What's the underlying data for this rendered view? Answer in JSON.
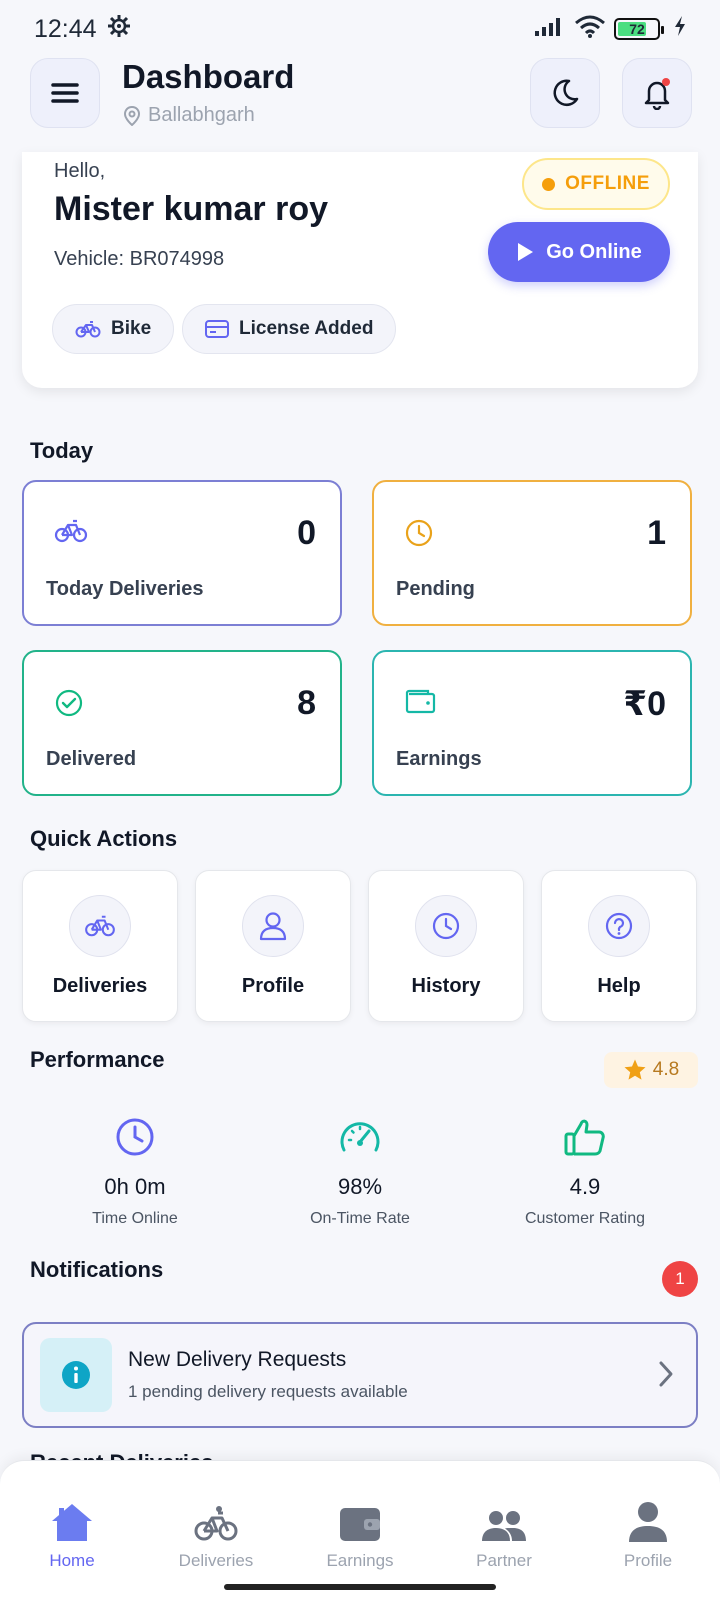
{
  "status_bar": {
    "time": "12:44",
    "battery": "72"
  },
  "header": {
    "title": "Dashboard",
    "location": "Ballabhgarh"
  },
  "driver": {
    "greeting": "Hello,",
    "name": "Mister kumar roy",
    "vehicle": "Vehicle: BR074998",
    "status": "OFFLINE",
    "go_online_label": "Go Online",
    "chips": [
      "Bike",
      "License Added"
    ]
  },
  "today": {
    "title": "Today",
    "stats": [
      {
        "label": "Today Deliveries",
        "value": "0"
      },
      {
        "label": "Pending",
        "value": "1"
      },
      {
        "label": "Delivered",
        "value": "8"
      },
      {
        "label": "Earnings",
        "value": "₹0"
      }
    ]
  },
  "quick_actions": {
    "title": "Quick Actions",
    "items": [
      "Deliveries",
      "Profile",
      "History",
      "Help"
    ]
  },
  "performance": {
    "title": "Performance",
    "rating": "4.8",
    "items": [
      {
        "value": "0h 0m",
        "label": "Time Online"
      },
      {
        "value": "98%",
        "label": "On-Time Rate"
      },
      {
        "value": "4.9",
        "label": "Customer Rating"
      }
    ]
  },
  "notifications": {
    "title": "Notifications",
    "count": "1",
    "item": {
      "title": "New Delivery Requests",
      "subtitle": "1 pending delivery requests available"
    }
  },
  "recent_title": "Recent Deliveries",
  "bottom_nav": [
    "Home",
    "Deliveries",
    "Earnings",
    "Partner",
    "Profile"
  ],
  "colors": {
    "accent": "#6366f1",
    "pending": "#f59e0b",
    "delivered": "#10b981",
    "earnings": "#14b8a6",
    "alert": "#ef4444"
  }
}
